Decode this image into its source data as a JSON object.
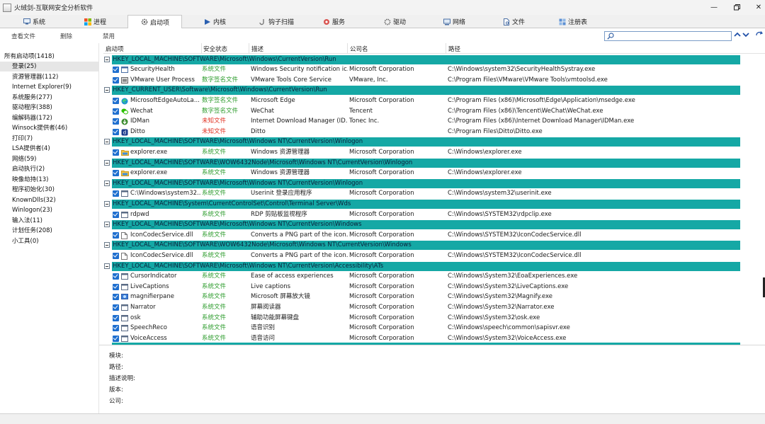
{
  "window": {
    "title": "火绒剑-互联网安全分析软件",
    "minimize_icon": "minimize-icon",
    "maximize_icon": "maximize-icon",
    "close_icon": "close-icon"
  },
  "tabs": [
    {
      "label": "系统",
      "icon": "monitor-icon"
    },
    {
      "label": "进程",
      "icon": "windows-icon"
    },
    {
      "label": "启动项",
      "icon": "gear-icon",
      "active": true
    },
    {
      "label": "内核",
      "icon": "arrow-icon"
    },
    {
      "label": "钩子扫描",
      "icon": "hook-icon"
    },
    {
      "label": "服务",
      "icon": "service-icon"
    },
    {
      "label": "驱动",
      "icon": "driver-icon"
    },
    {
      "label": "网络",
      "icon": "network-icon"
    },
    {
      "label": "文件",
      "icon": "file-icon"
    },
    {
      "label": "注册表",
      "icon": "registry-icon"
    }
  ],
  "toolbar": {
    "view_file": "查看文件",
    "delete": "删除",
    "disable": "禁用",
    "search_placeholder": ""
  },
  "sidebar": [
    {
      "label": "所有启动项(1418)"
    },
    {
      "label": "登录(25)",
      "selected": true
    },
    {
      "label": "资源管理器(112)"
    },
    {
      "label": "Internet Explorer(9)"
    },
    {
      "label": "系统服务(277)"
    },
    {
      "label": "驱动程序(388)"
    },
    {
      "label": "编解码器(172)"
    },
    {
      "label": "Winsock提供者(46)"
    },
    {
      "label": "打印(7)"
    },
    {
      "label": "LSA提供者(4)"
    },
    {
      "label": "网络(59)"
    },
    {
      "label": "启动执行(2)"
    },
    {
      "label": "映像劫持(13)"
    },
    {
      "label": "程序初始化(30)"
    },
    {
      "label": "KnownDlls(32)"
    },
    {
      "label": "Winlogon(23)"
    },
    {
      "label": "输入法(11)"
    },
    {
      "label": "计划任务(208)"
    },
    {
      "label": "小工具(0)"
    }
  ],
  "columns": {
    "startup": "启动项",
    "status": "安全状态",
    "desc": "描述",
    "company": "公司名",
    "path": "路径"
  },
  "rows": [
    {
      "type": "group",
      "text": "HKEY_LOCAL_MACHINE\\SOFTWARE\\Microsoft\\Windows\\CurrentVersion\\Run"
    },
    {
      "type": "item",
      "name": "SecurityHealth",
      "status": "系统文件",
      "st": "sys",
      "desc": "Windows Security notification ic...",
      "company": "Microsoft Corporation",
      "path": "C:\\Windows\\system32\\SecurityHealthSystray.exe",
      "icon": "shield"
    },
    {
      "type": "item",
      "name": "VMware User Process",
      "status": "数字签名文件",
      "st": "sig",
      "desc": "VMware Tools Core Service",
      "company": "VMware, Inc.",
      "path": "C:\\Program Files\\VMware\\VMware Tools\\vmtoolsd.exe",
      "icon": "vm"
    },
    {
      "type": "group",
      "text": "HKEY_CURRENT_USER\\Software\\Microsoft\\Windows\\CurrentVersion\\Run"
    },
    {
      "type": "item",
      "name": "MicrosoftEdgeAutoLa...",
      "status": "数字签名文件",
      "st": "sig",
      "desc": "Microsoft Edge",
      "company": "Microsoft Corporation",
      "path": "C:\\Program Files (x86)\\Microsoft\\Edge\\Application\\msedge.exe",
      "icon": "edge"
    },
    {
      "type": "item",
      "name": "Wechat",
      "status": "数字签名文件",
      "st": "sig",
      "desc": "WeChat",
      "company": "Tencent",
      "path": "C:\\Program Files (x86)\\Tencent\\WeChat\\WeChat.exe",
      "icon": "wechat"
    },
    {
      "type": "item",
      "name": "IDMan",
      "status": "未知文件",
      "st": "unk",
      "desc": "Internet Download Manager (ID...",
      "company": "Tonec Inc.",
      "path": "C:\\Program Files (x86)\\Internet Download Manager\\IDMan.exe",
      "icon": "idm"
    },
    {
      "type": "item",
      "name": "Ditto",
      "status": "未知文件",
      "st": "unk",
      "desc": "Ditto",
      "company": "",
      "path": "C:\\Program Files\\Ditto\\Ditto.exe",
      "icon": "ditto"
    },
    {
      "type": "group",
      "text": "HKEY_LOCAL_MACHINE\\SOFTWARE\\Microsoft\\Windows NT\\CurrentVersion\\Winlogon"
    },
    {
      "type": "item",
      "name": "explorer.exe",
      "status": "系统文件",
      "st": "sys",
      "desc": "Windows 资源管理器",
      "company": "Microsoft Corporation",
      "path": "C:\\Windows\\explorer.exe",
      "icon": "folder"
    },
    {
      "type": "group",
      "text": "HKEY_LOCAL_MACHINE\\SOFTWARE\\WOW6432Node\\Microsoft\\Windows NT\\CurrentVersion\\Winlogon"
    },
    {
      "type": "item",
      "name": "explorer.exe",
      "status": "系统文件",
      "st": "sys",
      "desc": "Windows 资源管理器",
      "company": "Microsoft Corporation",
      "path": "C:\\Windows\\explorer.exe",
      "icon": "folder"
    },
    {
      "type": "group",
      "text": "HKEY_LOCAL_MACHINE\\SOFTWARE\\Microsoft\\Windows NT\\CurrentVersion\\Winlogon"
    },
    {
      "type": "item",
      "name": "C:\\Windows\\system32...",
      "status": "系统文件",
      "st": "sys",
      "desc": "Userinit 登录应用程序",
      "company": "Microsoft Corporation",
      "path": "C:\\Windows\\system32\\userinit.exe",
      "icon": "window"
    },
    {
      "type": "group",
      "text": "HKEY_LOCAL_MACHINE\\System\\CurrentControlSet\\Control\\Terminal Server\\Wds"
    },
    {
      "type": "item",
      "name": "rdpwd",
      "status": "系统文件",
      "st": "sys",
      "desc": "RDP 剪贴板监视程序",
      "company": "Microsoft Corporation",
      "path": "C:\\Windows\\SYSTEM32\\rdpclip.exe",
      "icon": "window"
    },
    {
      "type": "group",
      "text": "HKEY_LOCAL_MACHINE\\SOFTWARE\\Microsoft\\Windows NT\\CurrentVersion\\Windows"
    },
    {
      "type": "item",
      "name": "IconCodecService.dll",
      "status": "系统文件",
      "st": "sys",
      "desc": "Converts a PNG part of the icon...",
      "company": "Microsoft Corporation",
      "path": "C:\\Windows\\SYSTEM32\\IconCodecService.dll",
      "icon": "doc"
    },
    {
      "type": "group",
      "text": "HKEY_LOCAL_MACHINE\\SOFTWARE\\WOW6432Node\\Microsoft\\Windows NT\\CurrentVersion\\Windows"
    },
    {
      "type": "item",
      "name": "IconCodecService.dll",
      "status": "系统文件",
      "st": "sys",
      "desc": "Converts a PNG part of the icon...",
      "company": "Microsoft Corporation",
      "path": "C:\\Windows\\SYSTEM32\\IconCodecService.dll",
      "icon": "doc"
    },
    {
      "type": "group",
      "text": "HKEY_LOCAL_MACHINE\\SOFTWARE\\Microsoft\\Windows NT\\CurrentVersion\\Accessibility\\ATs"
    },
    {
      "type": "item",
      "name": "CursorIndicator",
      "status": "系统文件",
      "st": "sys",
      "desc": "Ease of access experiences",
      "company": "Microsoft Corporation",
      "path": "C:\\Windows\\System32\\EoaExperiences.exe",
      "icon": "window"
    },
    {
      "type": "item",
      "name": "LiveCaptions",
      "status": "系统文件",
      "st": "sys",
      "desc": "Live captions",
      "company": "Microsoft Corporation",
      "path": "C:\\Windows\\System32\\LiveCaptions.exe",
      "icon": "window"
    },
    {
      "type": "item",
      "name": "magnifierpane",
      "status": "系统文件",
      "st": "sys",
      "desc": "Microsoft 屏幕放大镜",
      "company": "Microsoft Corporation",
      "path": "C:\\Windows\\System32\\Magnify.exe",
      "icon": "magnifier"
    },
    {
      "type": "item",
      "name": "Narrator",
      "status": "系统文件",
      "st": "sys",
      "desc": "屏幕阅读器",
      "company": "Microsoft Corporation",
      "path": "C:\\Windows\\System32\\Narrator.exe",
      "icon": "window"
    },
    {
      "type": "item",
      "name": "osk",
      "status": "系统文件",
      "st": "sys",
      "desc": "辅助功能屏幕键盘",
      "company": "Microsoft Corporation",
      "path": "C:\\Windows\\System32\\osk.exe",
      "icon": "window"
    },
    {
      "type": "item",
      "name": "SpeechReco",
      "status": "系统文件",
      "st": "sys",
      "desc": "语音识别",
      "company": "Microsoft Corporation",
      "path": "C:\\Windows\\speech\\common\\sapisvr.exe",
      "icon": "window"
    },
    {
      "type": "item",
      "name": "VoiceAccess",
      "status": "系统文件",
      "st": "sys",
      "desc": "语音访问",
      "company": "Microsoft Corporation",
      "path": "C:\\Windows\\System32\\VoiceAccess.exe",
      "icon": "window"
    }
  ],
  "details": {
    "module": "模块:",
    "path": "路径:",
    "description": "描述说明:",
    "version": "版本:",
    "company": "公司:"
  }
}
